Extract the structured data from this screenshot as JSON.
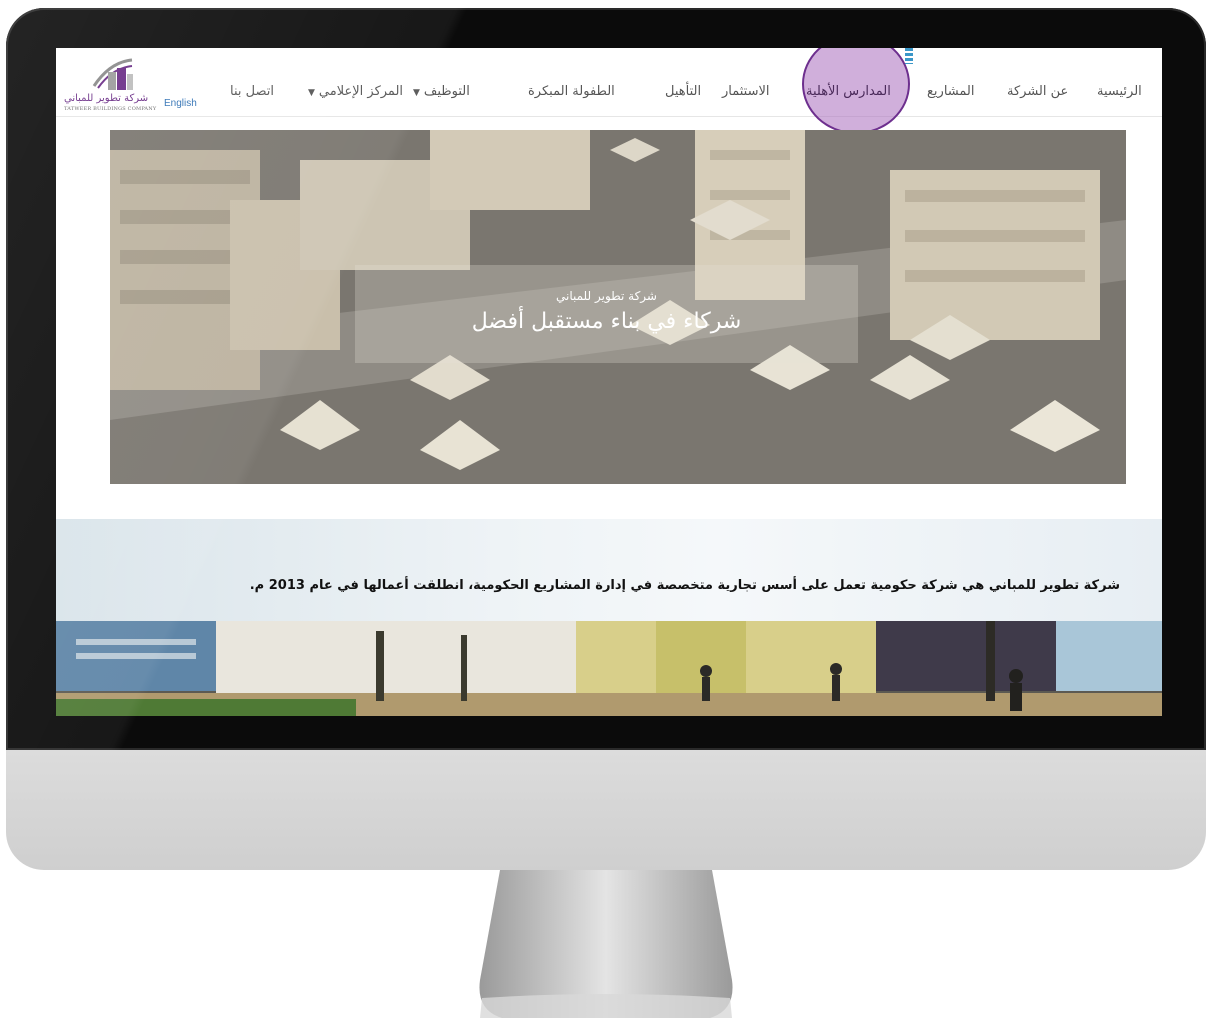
{
  "nav": {
    "language_link": "English",
    "logo": {
      "name_ar": "شركة تطوير للمباني",
      "name_en": "TATWEER BUILDINGS COMPANY"
    },
    "items": [
      {
        "label": "الرئيسية"
      },
      {
        "label": "عن الشركة"
      },
      {
        "label": "المشاريع"
      },
      {
        "label": "المدارس الأهلية",
        "highlighted": true
      },
      {
        "label": "الاستثمار"
      },
      {
        "label": "التأهيل"
      },
      {
        "label": "الطفولة المبكرة"
      },
      {
        "label": "التوظيف",
        "has_dropdown": true
      },
      {
        "label": "المركز الإعلامي",
        "has_dropdown": true
      },
      {
        "label": "اتصل بنا"
      }
    ]
  },
  "hero": {
    "subtitle": "شركة تطوير للمباني",
    "title": "شركاء في بناء مستقبل أفضل"
  },
  "intro": {
    "text": "شركة تطوير للمباني هي شركة حكومية تعمل على أسس تجارية متخصصة في إدارة المشاريع الحكومية، انطلقت أعمالها في عام 2013 م."
  },
  "colors": {
    "highlight_fill": "#b06ec0",
    "highlight_border": "#6d2f8e",
    "logo_purple": "#6a2c86",
    "link_blue": "#2d6fb3"
  }
}
